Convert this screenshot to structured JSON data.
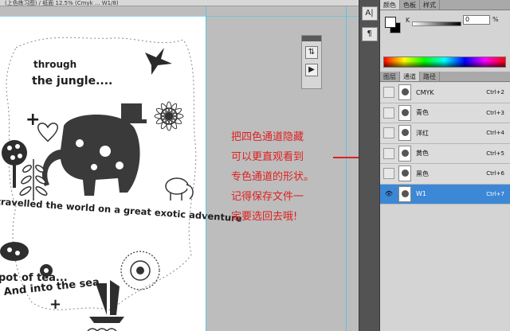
{
  "document": {
    "title": "(上色练习图) / 纸面 12.5% (Cmyk ... W1/8)"
  },
  "artwork": {
    "text_through": "through",
    "text_jungle": "the jungle....",
    "text_travelled": "travelled the world on a great exotic adventure",
    "text_pot": "pot of tea...",
    "text_into": "And into the sea",
    "plus_marks": [
      "+",
      "+"
    ]
  },
  "mini_panel": {
    "tool1_icon": "channel-mixer-icon",
    "tool2_icon": "play-icon"
  },
  "dock": {
    "tool1_label": "A|",
    "tool2_label": "¶"
  },
  "color_panel": {
    "tabs": [
      "颜色",
      "色板",
      "样式"
    ],
    "active_tab": "颜色",
    "k_label": "K",
    "k_value": "0",
    "k_unit": "%"
  },
  "channels_panel": {
    "tabs": [
      "图层",
      "通道",
      "路径"
    ],
    "active_tab": "通道",
    "channels": [
      {
        "name": "CMYK",
        "shortcut": "Ctrl+2",
        "visible": false,
        "selected": false
      },
      {
        "name": "青色",
        "shortcut": "Ctrl+3",
        "visible": false,
        "selected": false
      },
      {
        "name": "洋红",
        "shortcut": "Ctrl+4",
        "visible": false,
        "selected": false
      },
      {
        "name": "黄色",
        "shortcut": "Ctrl+5",
        "visible": false,
        "selected": false
      },
      {
        "name": "黑色",
        "shortcut": "Ctrl+6",
        "visible": false,
        "selected": false
      },
      {
        "name": "W1",
        "shortcut": "Ctrl+7",
        "visible": true,
        "selected": true
      }
    ]
  },
  "annotation": {
    "lines": [
      "把四色通道隐藏",
      "可以更直观看到",
      "专色通道的形状。",
      "记得保存文件一",
      "定要选回去哦!"
    ],
    "color": "#e02020"
  }
}
